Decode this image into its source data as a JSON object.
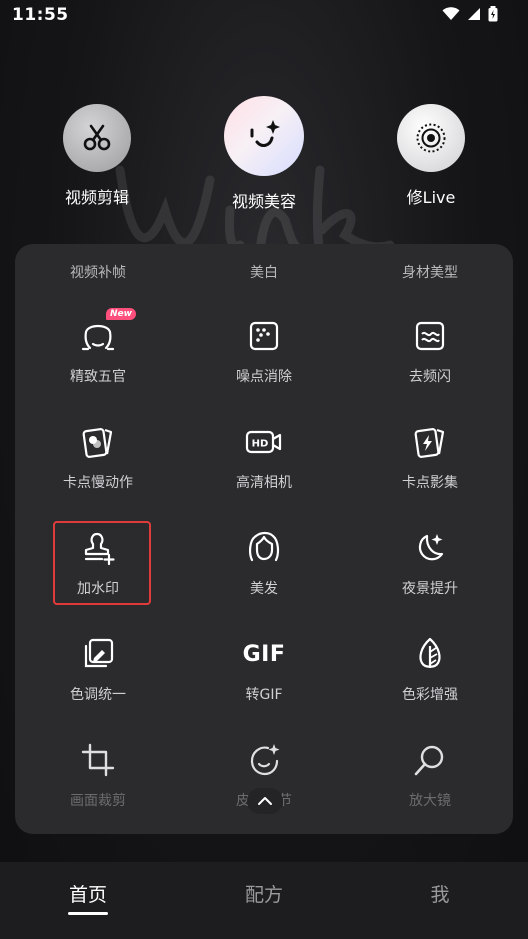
{
  "status_bar": {
    "time": "11:55"
  },
  "top_tools": [
    {
      "label": "视频剪辑",
      "icon": "scissors-icon"
    },
    {
      "label": "视频美容",
      "icon": "face-sparkle-icon"
    },
    {
      "label": "修Live",
      "icon": "live-photo-icon"
    }
  ],
  "panel": {
    "groups": [
      "视频补帧",
      "美白",
      "身材美型"
    ],
    "tools": [
      {
        "label": "精致五官",
        "icon": "face-outline-icon",
        "badge": "New"
      },
      {
        "label": "噪点消除",
        "icon": "noise-dots-icon"
      },
      {
        "label": "去频闪",
        "icon": "flicker-wave-icon"
      },
      {
        "label": "卡点慢动作",
        "icon": "slowmo-cards-icon"
      },
      {
        "label": "高清相机",
        "icon": "hd-camera-icon"
      },
      {
        "label": "卡点影集",
        "icon": "lightning-cards-icon"
      },
      {
        "label": "加水印",
        "icon": "stamp-add-icon"
      },
      {
        "label": "美发",
        "icon": "hair-icon"
      },
      {
        "label": "夜景提升",
        "icon": "moon-sparkle-icon"
      },
      {
        "label": "色调统一",
        "icon": "color-picker-icon"
      },
      {
        "label": "转GIF",
        "icon": "gif-icon",
        "icon_text": "GIF"
      },
      {
        "label": "色彩增强",
        "icon": "leaf-contrast-icon"
      },
      {
        "label": "画面裁剪",
        "icon": "crop-icon"
      },
      {
        "label": "皮肤细节",
        "icon": "skin-sparkle-icon"
      },
      {
        "label": "放大镜",
        "icon": "magnifier-icon"
      }
    ]
  },
  "bottom_nav": [
    {
      "label": "首页",
      "active": true
    },
    {
      "label": "配方",
      "active": false
    },
    {
      "label": "我",
      "active": false
    }
  ],
  "colors": {
    "panel_bg": "#2b2b2e",
    "highlight": "#e03b3b",
    "badge": "#ff4f7c"
  }
}
